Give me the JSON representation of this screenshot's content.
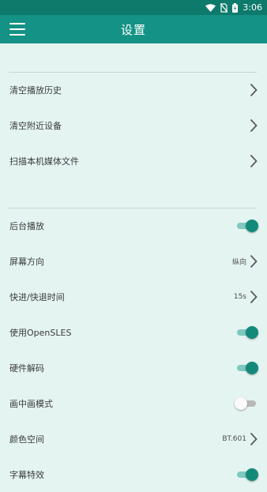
{
  "status_bar": {
    "time": "3:06"
  },
  "app_bar": {
    "title": "设置"
  },
  "colors": {
    "accent": "#13897a",
    "app_bar": "#149285",
    "status_bar": "#0e7a6b",
    "background": "#e4f5f1"
  },
  "group1": {
    "clear_history": "清空播放历史",
    "clear_nearby": "清空附近设备",
    "scan_media": "扫描本机媒体文件"
  },
  "group2": {
    "background_play": {
      "label": "后台播放",
      "on": true
    },
    "orientation": {
      "label": "屏幕方向",
      "value": "纵向"
    },
    "seek_time": {
      "label": "快进/快退时间",
      "value": "15s"
    },
    "opensles": {
      "label": "使用OpenSLES",
      "on": true
    },
    "hw_decode": {
      "label": "硬件解码",
      "on": true
    },
    "pip": {
      "label": "画中画模式",
      "on": false
    },
    "color_space": {
      "label": "颜色空间",
      "value": "BT.601"
    },
    "partial": {
      "label": "字幕特效",
      "on": true
    }
  }
}
